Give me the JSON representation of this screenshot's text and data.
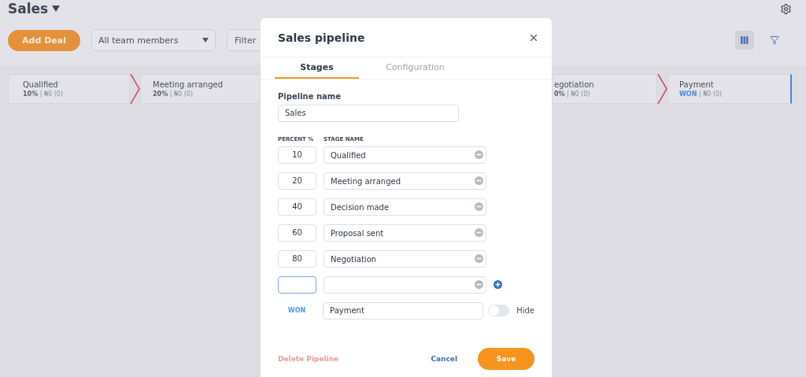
{
  "page": {
    "title": "Sales",
    "add_button": "Add Deal",
    "member_select": "All team members",
    "filter": {
      "placeholder": "Filter"
    },
    "views": [
      {
        "kind": "board",
        "selected": true
      },
      {
        "kind": "funnel",
        "selected": false
      }
    ],
    "stages_left": [
      {
        "name": "Qualified",
        "percent": "10%",
        "separator": "|",
        "amount": "₦0 (0)",
        "won": false
      },
      {
        "name": "Meeting arranged",
        "percent": "20%",
        "separator": "|",
        "amount": "₦0 (0)",
        "won": false
      }
    ],
    "stages_right": [
      {
        "name": "egotiation",
        "percent": "0%",
        "separator": "|",
        "amount": "₦0 (0)",
        "won": false
      },
      {
        "name": "Payment",
        "percent": "WON",
        "separator": "|",
        "amount": "₦0 (0)",
        "won": true
      }
    ]
  },
  "modal": {
    "title": "Sales pipeline",
    "tabs": [
      {
        "label": "Stages",
        "selected": true
      },
      {
        "label": "Configuration",
        "selected": false
      }
    ],
    "pipeline_name": {
      "label": "Pipeline name",
      "value": "Sales"
    },
    "columns": [
      "PERCENT %",
      "STAGE NAME"
    ],
    "stages": [
      {
        "percent": "10",
        "name": "Qualified",
        "focused": false
      },
      {
        "percent": "20",
        "name": "Meeting arranged",
        "focused": false
      },
      {
        "percent": "40",
        "name": "Decision made",
        "focused": false
      },
      {
        "percent": "60",
        "name": "Proposal sent",
        "focused": false
      },
      {
        "percent": "80",
        "name": "Negotiation",
        "focused": false
      },
      {
        "focused": true
      }
    ],
    "won_stage": {
      "label": "WON",
      "name": "Payment",
      "hide": {
        "label": "Hide",
        "on": false
      }
    },
    "buttons": {
      "delete": {
        "label": "Delete Pipeline",
        "disabled": true
      },
      "cancel": "Cancel",
      "save": "Save"
    }
  }
}
